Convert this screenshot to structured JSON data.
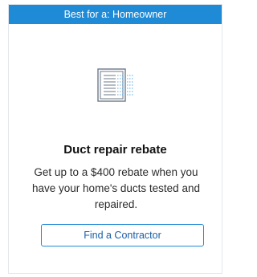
{
  "card": {
    "banner_text": "Best for a: Homeowner",
    "icon": "duct-vent-icon",
    "title": "Duct repair rebate",
    "description": "Get up to a $400 rebate when you have your home's ducts tested and repaired.",
    "cta_label": "Find a Contractor"
  },
  "colors": {
    "accent": "#1f8ad6",
    "cta_text": "#1a5fa8",
    "border": "#e3e6ea"
  }
}
